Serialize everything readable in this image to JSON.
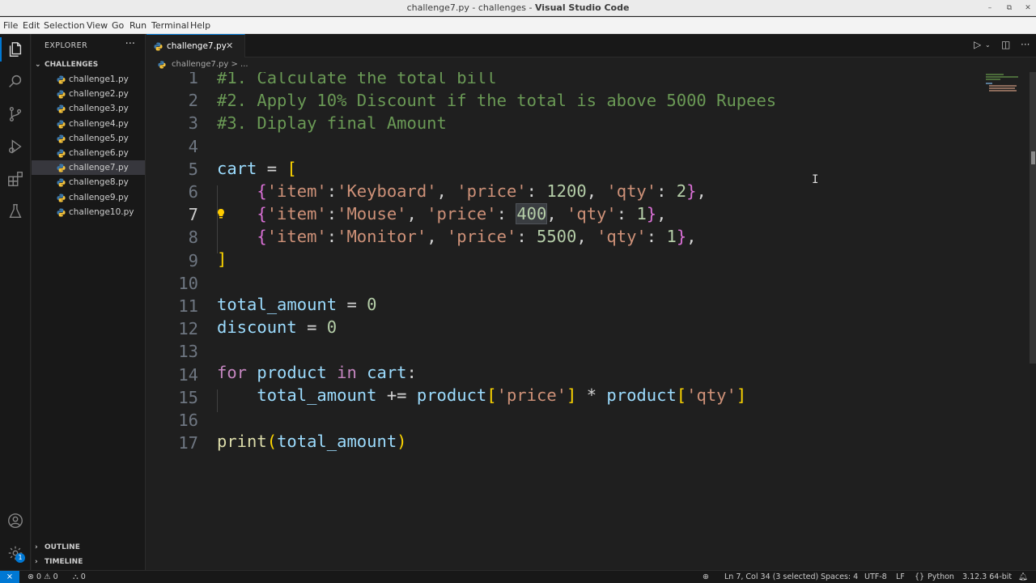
{
  "window": {
    "title_prefix": "challenge7.py - challenges - ",
    "title_app": "Visual Studio Code"
  },
  "menu": [
    "File",
    "Edit",
    "Selection",
    "View",
    "Go",
    "Run",
    "Terminal",
    "Help"
  ],
  "sidebar": {
    "header": "EXPLORER",
    "more": "···",
    "folder": "CHALLENGES",
    "files": [
      "challenge1.py",
      "challenge2.py",
      "challenge3.py",
      "challenge4.py",
      "challenge5.py",
      "challenge6.py",
      "challenge7.py",
      "challenge8.py",
      "challenge9.py",
      "challenge10.py"
    ],
    "selected_index": 6,
    "outline": "OUTLINE",
    "timeline": "TIMELINE"
  },
  "activity": {
    "accounts_badge": "1"
  },
  "tab": {
    "name": "challenge7.py",
    "close": "✕"
  },
  "breadcrumb": "challenge7.py > ...",
  "editor": {
    "line_numbers": [
      "1",
      "2",
      "3",
      "4",
      "5",
      "6",
      "7",
      "8",
      "9",
      "10",
      "11",
      "12",
      "13",
      "14",
      "15",
      "16",
      "17"
    ],
    "current_line": 7,
    "line1": "#1. Calculate the total bill",
    "line2": "#2. Apply 10% Discount if the total is above 5000 Rupees",
    "line3": "#3. Diplay final Amount",
    "cart_var": "cart",
    "items": [
      {
        "item": "'Keyboard'",
        "price": "1200",
        "qty": "2"
      },
      {
        "item": "'Mouse'",
        "price": "400",
        "qty": "1"
      },
      {
        "item": "'Monitor'",
        "price": "5500",
        "qty": "1"
      }
    ],
    "total_var": "total_amount",
    "discount_var": "discount",
    "zero": "0",
    "loop_var": "product",
    "key_item": "'item'",
    "key_price": "'price'",
    "key_qty": "'qty'",
    "kw_for": "for",
    "kw_in": "in",
    "fn_print": "print"
  },
  "status": {
    "errors": "0",
    "warnings": "0",
    "ports": "0",
    "cursor": "Ln 7, Col 34 (3 selected)",
    "spaces": "Spaces: 4",
    "encoding": "UTF-8",
    "eol": "LF",
    "language": "Python",
    "interpreter": "3.12.3 64-bit"
  }
}
